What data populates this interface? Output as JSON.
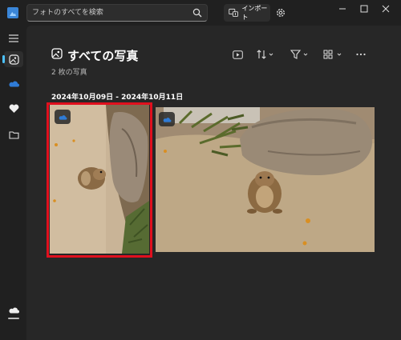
{
  "search": {
    "placeholder": "フォトのすべてを検索"
  },
  "header": {
    "import_label": "インポート"
  },
  "main": {
    "title": "すべての写真",
    "count": "2 枚の写真",
    "date_range": "2024年10月09日 - 2024年10月11日"
  },
  "photos": [
    {
      "subject": "squirrel",
      "orientation": "rotated",
      "selected": true,
      "cloud": true
    },
    {
      "subject": "squirrel",
      "orientation": "landscape",
      "selected": false,
      "cloud": true
    }
  ],
  "colors": {
    "accent": "#4cc2ff",
    "selection": "#e0101e",
    "onedrive": "#2f7bd6"
  },
  "icons": [
    "search-icon",
    "import-icon",
    "settings-icon",
    "minimize-icon",
    "maximize-icon",
    "close-icon",
    "menu-icon",
    "gallery-icon",
    "onedrive-icon",
    "favorites-icon",
    "folders-icon",
    "cloud-icon",
    "slideshow-icon",
    "sort-icon",
    "filter-icon",
    "view-icon",
    "more-icon"
  ]
}
